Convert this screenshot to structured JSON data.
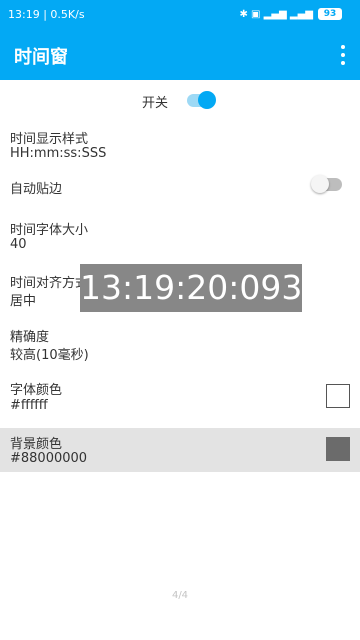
{
  "status_bar": {
    "time_speed": "13:19 | 0.5K/s",
    "indicators": "✱ ▣ ▂▄▆ ▂▄▆",
    "battery": "93"
  },
  "app_bar": {
    "title": "时间窗",
    "more_icon": "more-vert-icon"
  },
  "main_switch": {
    "label": "开关",
    "state": "on"
  },
  "settings": {
    "time_format": {
      "title": "时间显示样式",
      "value": "HH:mm:ss:SSS"
    },
    "auto_edge": {
      "title": "自动贴边",
      "state": "off"
    },
    "font_size": {
      "title": "时间字体大小",
      "value": "40"
    },
    "alignment": {
      "title": "时间对齐方式",
      "value": "居中"
    },
    "precision": {
      "title": "精确度",
      "value": "较高(10毫秒)"
    },
    "font_color": {
      "title": "字体颜色",
      "value": "#ffffff",
      "swatch": "#ffffff"
    },
    "bg_color": {
      "title": "背景颜色",
      "value": "#88000000",
      "swatch": "#6b6b6b"
    }
  },
  "floating_clock": {
    "time": "13:19:20:093"
  },
  "page_indicator": "4/4",
  "colors": {
    "primary": "#03a9f4",
    "toggle_track_on": "#9dd9f5",
    "selected_row": "#e3e3e3"
  }
}
